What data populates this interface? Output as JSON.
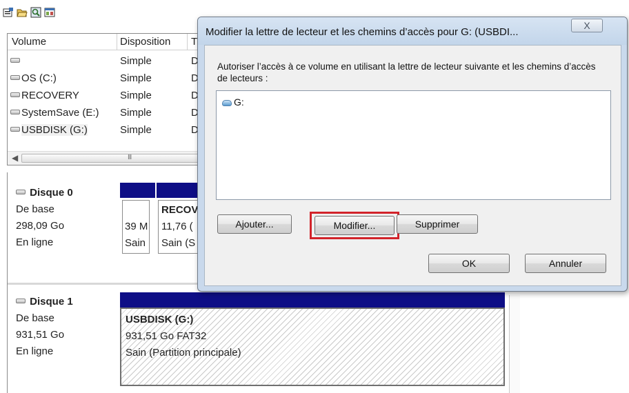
{
  "toolbar": {
    "icons": [
      "properties-icon",
      "open-folder-icon",
      "search-icon",
      "console-icon"
    ]
  },
  "volume_list": {
    "columns": {
      "volume": "Volume",
      "layout": "Disposition",
      "type": "T"
    },
    "rows": [
      {
        "name": "",
        "layout": "Simple",
        "type": "D"
      },
      {
        "name": "OS (C:)",
        "layout": "Simple",
        "type": "D"
      },
      {
        "name": "RECOVERY",
        "layout": "Simple",
        "type": "D"
      },
      {
        "name": "SystemSave (E:)",
        "layout": "Simple",
        "type": "D"
      },
      {
        "name": "USBDISK (G:)",
        "layout": "Simple",
        "type": "D"
      }
    ],
    "scroll_grip": "III"
  },
  "disks": [
    {
      "title": "Disque 0",
      "kind": "De base",
      "size": "298,09 Go",
      "status": "En ligne",
      "partitions": [
        {
          "name": "",
          "size": "39 M",
          "status": "Sain"
        },
        {
          "name": "RECOV",
          "size": "11,76 (",
          "status": "Sain (S"
        }
      ]
    },
    {
      "title": "Disque 1",
      "kind": "De base",
      "size": "931,51 Go",
      "status": "En ligne",
      "partitions": [
        {
          "name": "USBDISK  (G:)",
          "size": "931,51 Go FAT32",
          "status": "Sain (Partition principale)"
        }
      ]
    }
  ],
  "dialog": {
    "title": "Modifier la lettre de lecteur et les chemins d’accès pour G: (USBDI...",
    "close_label": "X",
    "description": "Autoriser l’accès à ce volume en utilisant la lettre de lecteur suivante et les chemins d’accès de lecteurs :",
    "paths": [
      "G:"
    ],
    "buttons": {
      "add": "Ajouter...",
      "modify": "Modifier...",
      "remove": "Supprimer",
      "ok": "OK",
      "cancel": "Annuler"
    },
    "highlighted_button": "modify",
    "highlight_color": "#d2232a"
  }
}
